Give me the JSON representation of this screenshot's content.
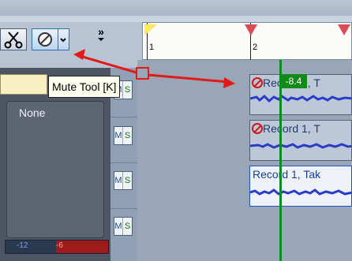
{
  "toolbar": {
    "buttons": [
      {
        "name": "scissors-tool"
      },
      {
        "name": "mute-tool",
        "selected": true
      }
    ],
    "more_label": "»"
  },
  "tooltip": {
    "text": "Mute Tool [K]"
  },
  "ruler": {
    "marks": [
      "1",
      "2"
    ]
  },
  "track_panel": {
    "channel": "None"
  },
  "meter": {
    "labels": [
      "-12",
      "-6"
    ]
  },
  "ms_buttons": [
    {
      "mute_label": "M",
      "solo_label": "S"
    },
    {
      "mute_label": "M",
      "solo_label": "S"
    },
    {
      "mute_label": "M",
      "solo_label": "S"
    },
    {
      "mute_label": "M",
      "solo_label": "S"
    }
  ],
  "clips": [
    {
      "title": "Record 1, T",
      "muted": true
    },
    {
      "title": "Record 1, T",
      "muted": true
    },
    {
      "title": "Record 1, Tak",
      "muted": false
    }
  ],
  "playhead": {
    "value": "-8.4"
  },
  "colors": {
    "tooltip_bg": "#fffff0",
    "playhead": "#0c8a23",
    "annotation_red": "#e21a1a",
    "selected_tool": "#2d6db0"
  }
}
